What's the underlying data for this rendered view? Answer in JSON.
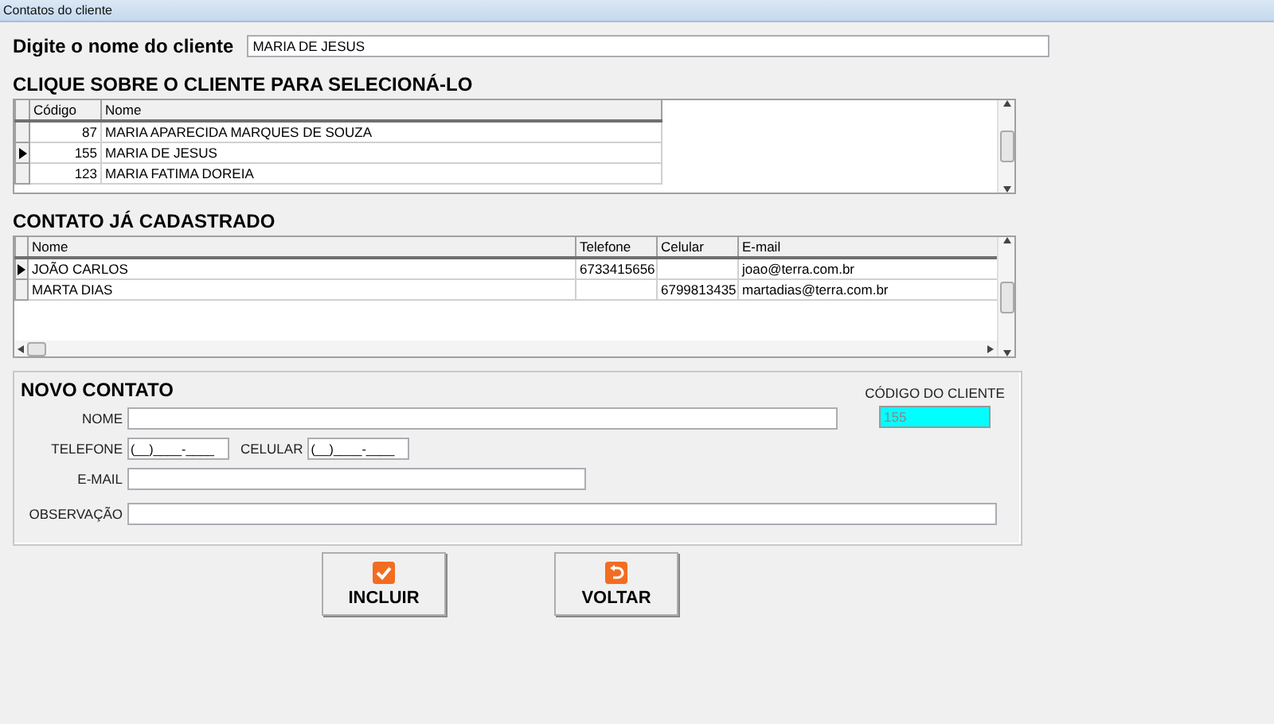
{
  "window": {
    "title": "Contatos do cliente"
  },
  "search": {
    "label": "Digite o nome do cliente",
    "value": "MARIA DE JESUS"
  },
  "clients": {
    "heading": "CLIQUE SOBRE O CLIENTE PARA SELECIONÁ-LO",
    "columns": [
      "Código",
      "Nome"
    ],
    "rows": [
      {
        "code": "87",
        "name": "MARIA APARECIDA MARQUES DE SOUZA",
        "selected": false
      },
      {
        "code": "155",
        "name": "MARIA DE JESUS",
        "selected": true
      },
      {
        "code": "123",
        "name": "MARIA FATIMA DOREIA",
        "selected": false
      }
    ]
  },
  "contacts": {
    "heading": "CONTATO JÁ CADASTRADO",
    "columns": [
      "Nome",
      "Telefone",
      "Celular",
      "E-mail"
    ],
    "rows": [
      {
        "cells": [
          "JOÃO CARLOS",
          "6733415656",
          "",
          "joao@terra.com.br"
        ],
        "selected": true
      },
      {
        "cells": [
          "MARTA DIAS",
          "",
          "6799813435",
          "martadias@terra.com.br"
        ],
        "selected": false
      }
    ]
  },
  "new_contact": {
    "heading": "NOVO CONTATO",
    "client_code_label": "CÓDIGO DO CLIENTE",
    "client_code": "155",
    "name_label": "NOME",
    "phone_label": "TELEFONE",
    "phone_value": "(__)____-____",
    "mobile_label": "CELULAR",
    "mobile_value": "(__)____-____",
    "email_label": "E-MAIL",
    "note_label": "OBSERVAÇÃO"
  },
  "buttons": [
    {
      "label": "INCLUIR",
      "kind": "check"
    },
    {
      "label": "VOLTAR",
      "kind": "back"
    }
  ]
}
